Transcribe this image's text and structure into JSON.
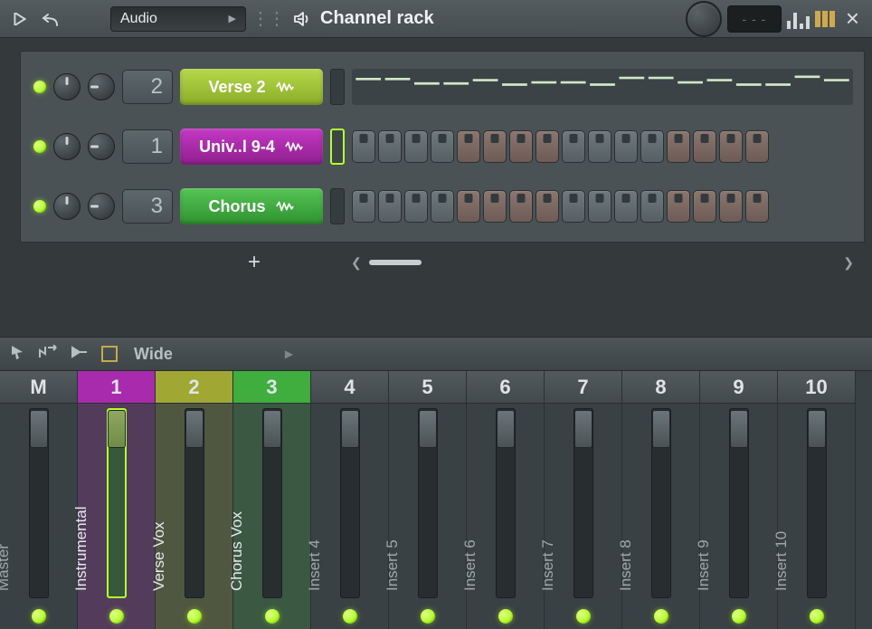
{
  "topbar": {
    "combo_label": "Audio",
    "title": "Channel rack",
    "digits": "- - -"
  },
  "channels": [
    {
      "mixer_slot": "2",
      "name": "Verse 2",
      "color": "green",
      "selected": false,
      "mode": "automation"
    },
    {
      "mixer_slot": "1",
      "name": "Univ..l 9-4",
      "color": "purple",
      "selected": true,
      "mode": "steps"
    },
    {
      "mixer_slot": "3",
      "name": "Chorus",
      "color": "green2",
      "selected": false,
      "mode": "steps"
    }
  ],
  "step_pattern_alt_groups": [
    0,
    0,
    0,
    0,
    1,
    1,
    1,
    1,
    0,
    0,
    0,
    0,
    1,
    1,
    1,
    1
  ],
  "automation_levels": [
    0.85,
    0.85,
    0.65,
    0.65,
    0.8,
    0.6,
    0.7,
    0.7,
    0.6,
    0.9,
    0.9,
    0.7,
    0.8,
    0.6,
    0.6,
    0.95,
    0.8
  ],
  "mixer_top": {
    "view_label": "Wide"
  },
  "mixer_tracks": [
    {
      "num": "M",
      "name": "Master",
      "color": "",
      "selected": false
    },
    {
      "num": "1",
      "name": "Instrumental",
      "color": "purple",
      "selected": true
    },
    {
      "num": "2",
      "name": "Verse Vox",
      "color": "olive",
      "selected": false
    },
    {
      "num": "3",
      "name": "Chorus Vox",
      "color": "green",
      "selected": false
    },
    {
      "num": "4",
      "name": "Insert 4",
      "color": "",
      "selected": false
    },
    {
      "num": "5",
      "name": "Insert 5",
      "color": "",
      "selected": false
    },
    {
      "num": "6",
      "name": "Insert 6",
      "color": "",
      "selected": false
    },
    {
      "num": "7",
      "name": "Insert 7",
      "color": "",
      "selected": false
    },
    {
      "num": "8",
      "name": "Insert 8",
      "color": "",
      "selected": false
    },
    {
      "num": "9",
      "name": "Insert 9",
      "color": "",
      "selected": false
    },
    {
      "num": "10",
      "name": "Insert 10",
      "color": "",
      "selected": false
    }
  ]
}
